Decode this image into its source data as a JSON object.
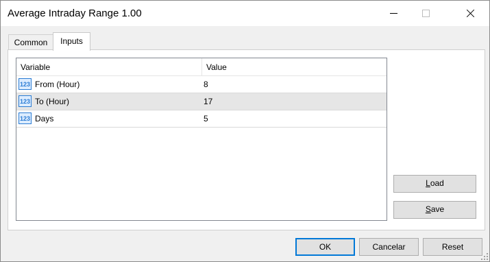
{
  "window": {
    "title": "Average Intraday Range 1.00"
  },
  "tabs": [
    {
      "label": "Common"
    },
    {
      "label": "Inputs"
    }
  ],
  "table": {
    "columns": [
      "Variable",
      "Value"
    ],
    "rows": [
      {
        "variable": "From (Hour)",
        "value": "8",
        "icon": "integer-123-icon"
      },
      {
        "variable": "To (Hour)",
        "value": "17",
        "icon": "integer-123-icon"
      },
      {
        "variable": "Days",
        "value": "5",
        "icon": "integer-123-icon"
      }
    ],
    "selected_row": 1
  },
  "side_buttons": {
    "load_first": "L",
    "load_rest": "oad",
    "save_first": "S",
    "save_rest": "ave"
  },
  "buttons": {
    "ok": "OK",
    "cancel": "Cancelar",
    "reset": "Reset"
  },
  "colors": {
    "accent": "#0078d7",
    "selected_row": "#e6e6e6",
    "icon_blue": "#2b7cd3"
  }
}
